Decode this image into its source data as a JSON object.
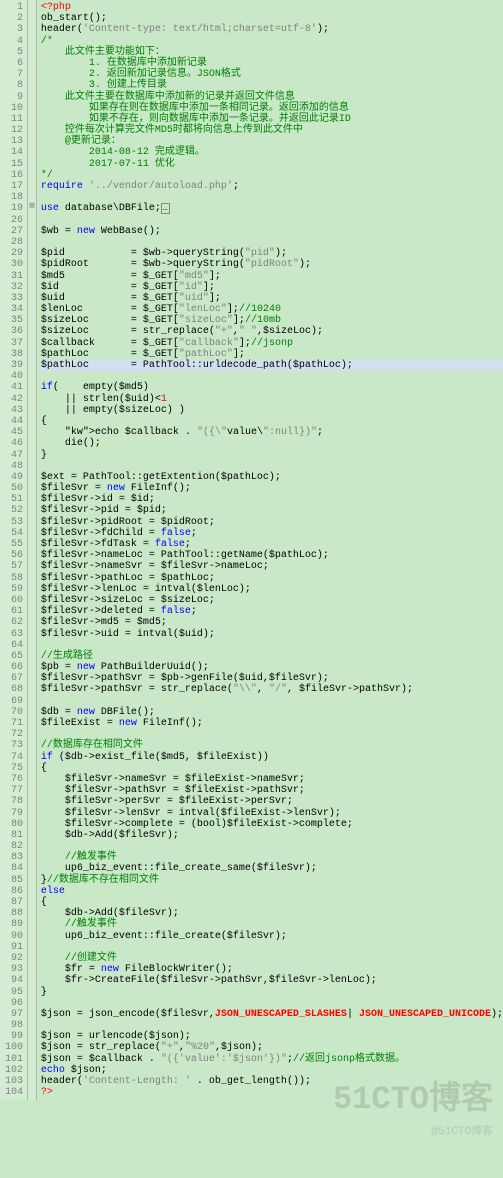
{
  "lines": [
    {
      "n": 1,
      "t": "php-open",
      "c": "<?php"
    },
    {
      "n": 2,
      "t": "code",
      "c": "ob_start();"
    },
    {
      "n": 3,
      "t": "code",
      "c": "header('Content-type: text/html;charset=utf-8');"
    },
    {
      "n": 4,
      "t": "cm",
      "c": "/*"
    },
    {
      "n": 5,
      "t": "cm",
      "c": "    此文件主要功能如下："
    },
    {
      "n": 6,
      "t": "cm",
      "c": "        1. 在数据库中添加新记录"
    },
    {
      "n": 7,
      "t": "cm",
      "c": "        2. 返回新加记录信息。JSON格式"
    },
    {
      "n": 8,
      "t": "cm",
      "c": "        3. 创建上传目录"
    },
    {
      "n": 9,
      "t": "cm",
      "c": "    此文件主要在数据库中添加新的记录并返回文件信息"
    },
    {
      "n": 10,
      "t": "cm",
      "c": "        如果存在则在数据库中添加一条相同记录。返回添加的信息"
    },
    {
      "n": 11,
      "t": "cm",
      "c": "        如果不存在，则向数据库中添加一条记录。并返回此记录ID"
    },
    {
      "n": 12,
      "t": "cm",
      "c": "    控件每次计算完文件MD5时都将向信息上传到此文件中"
    },
    {
      "n": 13,
      "t": "cm",
      "c": "    @更新记录："
    },
    {
      "n": 14,
      "t": "cm",
      "c": "        2014-08-12 完成逻辑。"
    },
    {
      "n": 15,
      "t": "cm",
      "c": "        2017-07-11 优化"
    },
    {
      "n": 16,
      "t": "cm",
      "c": "*/"
    },
    {
      "n": 17,
      "t": "req",
      "c": "require '../vendor/autoload.php';"
    },
    {
      "n": 18,
      "t": "blank",
      "c": ""
    },
    {
      "n": 19,
      "t": "use",
      "c": "use database\\DBFile;",
      "fold": "+"
    },
    {
      "n": 26,
      "t": "blank",
      "c": ""
    },
    {
      "n": 27,
      "t": "new",
      "c": "$wb = new WebBase();"
    },
    {
      "n": 28,
      "t": "blank",
      "c": ""
    },
    {
      "n": 29,
      "t": "assign",
      "c": "$pid           = $wb->queryString(\"pid\");"
    },
    {
      "n": 30,
      "t": "assign",
      "c": "$pidRoot       = $wb->queryString(\"pidRoot\");"
    },
    {
      "n": 31,
      "t": "assign",
      "c": "$md5           = $_GET[\"md5\"];"
    },
    {
      "n": 32,
      "t": "assign",
      "c": "$id            = $_GET[\"id\"];"
    },
    {
      "n": 33,
      "t": "assign",
      "c": "$uid           = $_GET[\"uid\"];"
    },
    {
      "n": 34,
      "t": "assign-cm",
      "c": "$lenLoc        = $_GET[\"lenLoc\"];//10240"
    },
    {
      "n": 35,
      "t": "assign-cm",
      "c": "$sizeLoc       = $_GET[\"sizeLoc\"];//10mb"
    },
    {
      "n": 36,
      "t": "assign",
      "c": "$sizeLoc       = str_replace(\"+\",\" \",$sizeLoc);"
    },
    {
      "n": 37,
      "t": "assign-cm",
      "c": "$callback      = $_GET[\"callback\"];//jsonp"
    },
    {
      "n": 38,
      "t": "assign",
      "c": "$pathLoc       = $_GET[\"pathLoc\"];"
    },
    {
      "n": 39,
      "t": "assign",
      "c": "$pathLoc       = PathTool::urldecode_path($pathLoc);",
      "hl": true
    },
    {
      "n": 40,
      "t": "blank",
      "c": ""
    },
    {
      "n": 41,
      "t": "if",
      "c": "if(    empty($md5)"
    },
    {
      "n": 42,
      "t": "code",
      "c": "    || strlen($uid)<1"
    },
    {
      "n": 43,
      "t": "code",
      "c": "    || empty($sizeLoc) )"
    },
    {
      "n": 44,
      "t": "code",
      "c": "{"
    },
    {
      "n": 45,
      "t": "echo",
      "c": "    echo $callback . \"({\\\"value\\\":null})\";"
    },
    {
      "n": 46,
      "t": "code",
      "c": "    die();"
    },
    {
      "n": 47,
      "t": "code",
      "c": "}"
    },
    {
      "n": 48,
      "t": "blank",
      "c": ""
    },
    {
      "n": 49,
      "t": "code",
      "c": "$ext = PathTool::getExtention($pathLoc);"
    },
    {
      "n": 50,
      "t": "new",
      "c": "$fileSvr = new FileInf();"
    },
    {
      "n": 51,
      "t": "code",
      "c": "$fileSvr->id = $id;"
    },
    {
      "n": 52,
      "t": "code",
      "c": "$fileSvr->pid = $pid;"
    },
    {
      "n": 53,
      "t": "code",
      "c": "$fileSvr->pidRoot = $pidRoot;"
    },
    {
      "n": 54,
      "t": "bool",
      "c": "$fileSvr->fdChild = false;"
    },
    {
      "n": 55,
      "t": "bool",
      "c": "$fileSvr->fdTask = false;"
    },
    {
      "n": 56,
      "t": "code",
      "c": "$fileSvr->nameLoc = PathTool::getName($pathLoc);"
    },
    {
      "n": 57,
      "t": "code",
      "c": "$fileSvr->nameSvr = $fileSvr->nameLoc;"
    },
    {
      "n": 58,
      "t": "code",
      "c": "$fileSvr->pathLoc = $pathLoc;"
    },
    {
      "n": 59,
      "t": "code",
      "c": "$fileSvr->lenLoc = intval($lenLoc);"
    },
    {
      "n": 60,
      "t": "code",
      "c": "$fileSvr->sizeLoc = $sizeLoc;"
    },
    {
      "n": 61,
      "t": "bool",
      "c": "$fileSvr->deleted = false;"
    },
    {
      "n": 62,
      "t": "code",
      "c": "$fileSvr->md5 = $md5;"
    },
    {
      "n": 63,
      "t": "code",
      "c": "$fileSvr->uid = intval($uid);"
    },
    {
      "n": 64,
      "t": "blank",
      "c": ""
    },
    {
      "n": 65,
      "t": "cm2",
      "c": "//生成路径"
    },
    {
      "n": 66,
      "t": "new",
      "c": "$pb = new PathBuilderUuid();"
    },
    {
      "n": 67,
      "t": "code",
      "c": "$fileSvr->pathSvr = $pb->genFile($uid,$fileSvr);"
    },
    {
      "n": 68,
      "t": "code",
      "c": "$fileSvr->pathSvr = str_replace(\"\\\\\", \"/\", $fileSvr->pathSvr);"
    },
    {
      "n": 69,
      "t": "blank",
      "c": ""
    },
    {
      "n": 70,
      "t": "new",
      "c": "$db = new DBFile();"
    },
    {
      "n": 71,
      "t": "new",
      "c": "$fileExist = new FileInf();"
    },
    {
      "n": 72,
      "t": "blank",
      "c": ""
    },
    {
      "n": 73,
      "t": "cm2",
      "c": "//数据库存在相同文件"
    },
    {
      "n": 74,
      "t": "if",
      "c": "if ($db->exist_file($md5, $fileExist))"
    },
    {
      "n": 75,
      "t": "code",
      "c": "{"
    },
    {
      "n": 76,
      "t": "code",
      "c": "    $fileSvr->nameSvr = $fileExist->nameSvr;"
    },
    {
      "n": 77,
      "t": "code",
      "c": "    $fileSvr->pathSvr = $fileExist->pathSvr;"
    },
    {
      "n": 78,
      "t": "code",
      "c": "    $fileSvr->perSvr = $fileExist->perSvr;"
    },
    {
      "n": 79,
      "t": "code",
      "c": "    $fileSvr->lenSvr = intval($fileExist->lenSvr);"
    },
    {
      "n": 80,
      "t": "code",
      "c": "    $fileSvr->complete = (bool)$fileExist->complete;"
    },
    {
      "n": 81,
      "t": "code",
      "c": "    $db->Add($fileSvr);"
    },
    {
      "n": 82,
      "t": "blank",
      "c": ""
    },
    {
      "n": 83,
      "t": "cm2",
      "c": "    //触发事件"
    },
    {
      "n": 84,
      "t": "code",
      "c": "    up6_biz_event::file_create_same($fileSvr);"
    },
    {
      "n": 85,
      "t": "brace-cm",
      "c": "}//数据库不存在相同文件"
    },
    {
      "n": 86,
      "t": "kw",
      "c": "else"
    },
    {
      "n": 87,
      "t": "code",
      "c": "{"
    },
    {
      "n": 88,
      "t": "code",
      "c": "    $db->Add($fileSvr);"
    },
    {
      "n": 89,
      "t": "cm2",
      "c": "    //触发事件"
    },
    {
      "n": 90,
      "t": "code",
      "c": "    up6_biz_event::file_create($fileSvr);"
    },
    {
      "n": 91,
      "t": "blank",
      "c": ""
    },
    {
      "n": 92,
      "t": "cm2",
      "c": "    //创建文件"
    },
    {
      "n": 93,
      "t": "new",
      "c": "    $fr = new FileBlockWriter();"
    },
    {
      "n": 94,
      "t": "code",
      "c": "    $fr->CreateFile($fileSvr->pathSvr,$fileSvr->lenLoc);"
    },
    {
      "n": 95,
      "t": "code",
      "c": "}"
    },
    {
      "n": 96,
      "t": "blank",
      "c": ""
    },
    {
      "n": 97,
      "t": "flags",
      "c": "$json = json_encode($fileSvr,JSON_UNESCAPED_SLASHES| JSON_UNESCAPED_UNICODE);"
    },
    {
      "n": 98,
      "t": "blank",
      "c": ""
    },
    {
      "n": 99,
      "t": "code",
      "c": "$json = urlencode($json);"
    },
    {
      "n": 100,
      "t": "code",
      "c": "$json = str_replace(\"+\",\"%20\",$json);"
    },
    {
      "n": 101,
      "t": "echo-cm",
      "c": "$json = $callback . \"({'value':'$json'})\";//返回jsonp格式数据。"
    },
    {
      "n": 102,
      "t": "kw",
      "c": "echo $json;"
    },
    {
      "n": 103,
      "t": "code",
      "c": "header('Content-Length: ' . ob_get_length());"
    },
    {
      "n": 104,
      "t": "php-close",
      "c": "?>"
    }
  ],
  "watermark_main": "51CTO博客",
  "watermark_sub": "@51CTO博客"
}
